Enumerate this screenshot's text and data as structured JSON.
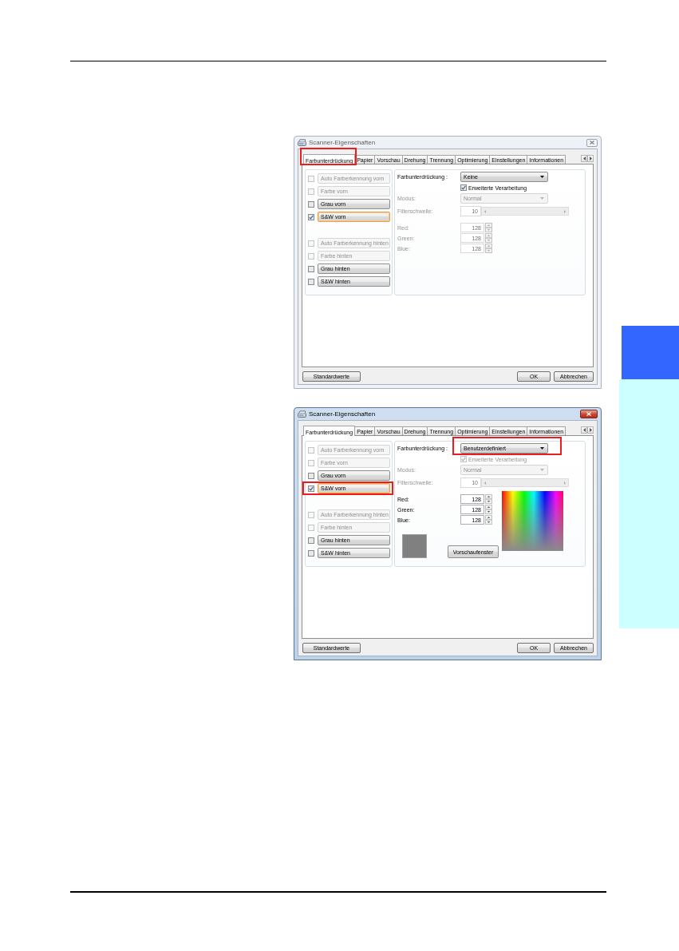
{
  "dialogs": [
    {
      "title": "Scanner-Eigenschaften",
      "active": false,
      "tabs": [
        {
          "label": "Farbunterdrückung",
          "selected": true,
          "highlighted": true
        },
        {
          "label": "Papier",
          "selected": false,
          "highlighted": false
        },
        {
          "label": "Vorschau",
          "selected": false,
          "highlighted": false
        },
        {
          "label": "Drehung",
          "selected": false,
          "highlighted": false
        },
        {
          "label": "Trennung",
          "selected": false,
          "highlighted": false
        },
        {
          "label": "Optimierung",
          "selected": false,
          "highlighted": false
        },
        {
          "label": "Einstellungen",
          "selected": false,
          "highlighted": false
        },
        {
          "label": "Informationen",
          "selected": false,
          "highlighted": false
        }
      ],
      "option_groups": [
        [
          {
            "label": "Auto Farberkennung vorn",
            "checked": false,
            "disabled": true,
            "focused": false,
            "highlighted": false
          },
          {
            "label": "Farbe vorn",
            "checked": false,
            "disabled": true,
            "focused": false,
            "highlighted": false
          },
          {
            "label": "Grau vorn",
            "checked": false,
            "disabled": false,
            "focused": false,
            "highlighted": false
          },
          {
            "label": "S&W vorn",
            "checked": true,
            "disabled": false,
            "focused": true,
            "highlighted": false
          }
        ],
        [
          {
            "label": "Auto Farberkennung hinten",
            "checked": false,
            "disabled": true,
            "focused": false,
            "highlighted": false
          },
          {
            "label": "Farbe hinten",
            "checked": false,
            "disabled": true,
            "focused": false,
            "highlighted": false
          },
          {
            "label": "Grau hinten",
            "checked": false,
            "disabled": false,
            "focused": false,
            "highlighted": false
          },
          {
            "label": "S&W hinten",
            "checked": false,
            "disabled": false,
            "focused": false,
            "highlighted": false
          }
        ]
      ],
      "settings": {
        "dropout": {
          "label": "Farbunterdrückung :",
          "value": "Keine",
          "highlighted": false
        },
        "advanced": {
          "label": "Erweiterte Verarbeitung",
          "checked": true,
          "disabled": false
        },
        "mode": {
          "label": "Modus:",
          "value": "Normal",
          "disabled": true
        },
        "threshold": {
          "label": "Filterschwelle:",
          "value": "10",
          "disabled": true
        },
        "rgb": [
          {
            "label": "Red:",
            "value": "128",
            "disabled": true
          },
          {
            "label": "Green:",
            "value": "128",
            "disabled": true
          },
          {
            "label": "Blue:",
            "value": "128",
            "disabled": true
          }
        ]
      },
      "buttons": [
        "Standardwerte",
        "OK",
        "Abbrechen"
      ]
    },
    {
      "title": "Scanner-Eigenschaften",
      "active": true,
      "tabs": [
        {
          "label": "Farbunterdrückung",
          "selected": true,
          "highlighted": false
        },
        {
          "label": "Papier",
          "selected": false,
          "highlighted": false
        },
        {
          "label": "Vorschau",
          "selected": false,
          "highlighted": false
        },
        {
          "label": "Drehung",
          "selected": false,
          "highlighted": false
        },
        {
          "label": "Trennung",
          "selected": false,
          "highlighted": false
        },
        {
          "label": "Optimierung",
          "selected": false,
          "highlighted": false
        },
        {
          "label": "Einstellungen",
          "selected": false,
          "highlighted": false
        },
        {
          "label": "Informationen",
          "selected": false,
          "highlighted": false
        }
      ],
      "option_groups": [
        [
          {
            "label": "Auto Farberkennung vorn",
            "checked": false,
            "disabled": true,
            "focused": false,
            "highlighted": false
          },
          {
            "label": "Farbe vorn",
            "checked": false,
            "disabled": true,
            "focused": false,
            "highlighted": false
          },
          {
            "label": "Grau vorn",
            "checked": false,
            "disabled": false,
            "focused": false,
            "highlighted": false
          },
          {
            "label": "S&W vorn",
            "checked": true,
            "disabled": false,
            "focused": true,
            "highlighted": true
          }
        ],
        [
          {
            "label": "Auto Farberkennung hinten",
            "checked": false,
            "disabled": true,
            "focused": false,
            "highlighted": false
          },
          {
            "label": "Farbe hinten",
            "checked": false,
            "disabled": true,
            "focused": false,
            "highlighted": false
          },
          {
            "label": "Grau hinten",
            "checked": false,
            "disabled": false,
            "focused": false,
            "highlighted": false
          },
          {
            "label": "S&W hinten",
            "checked": false,
            "disabled": false,
            "focused": false,
            "highlighted": false
          }
        ]
      ],
      "settings": {
        "dropout": {
          "label": "Farbunterdrückung :",
          "value": "Benutzerdefiniert",
          "highlighted": true
        },
        "advanced": {
          "label": "Erweiterte Verarbeitung",
          "checked": true,
          "disabled": true
        },
        "mode": {
          "label": "Modus:",
          "value": "Normal",
          "disabled": true
        },
        "threshold": {
          "label": "Filterschwelle:",
          "value": "10",
          "disabled": true
        },
        "rgb": [
          {
            "label": "Red:",
            "value": "128",
            "disabled": false
          },
          {
            "label": "Green:",
            "value": "128",
            "disabled": false
          },
          {
            "label": "Blue:",
            "value": "128",
            "disabled": false
          }
        ]
      },
      "preview": {
        "button": "Vorschaufenster"
      },
      "buttons": [
        "Standardwerte",
        "OK",
        "Abbrechen"
      ]
    }
  ]
}
